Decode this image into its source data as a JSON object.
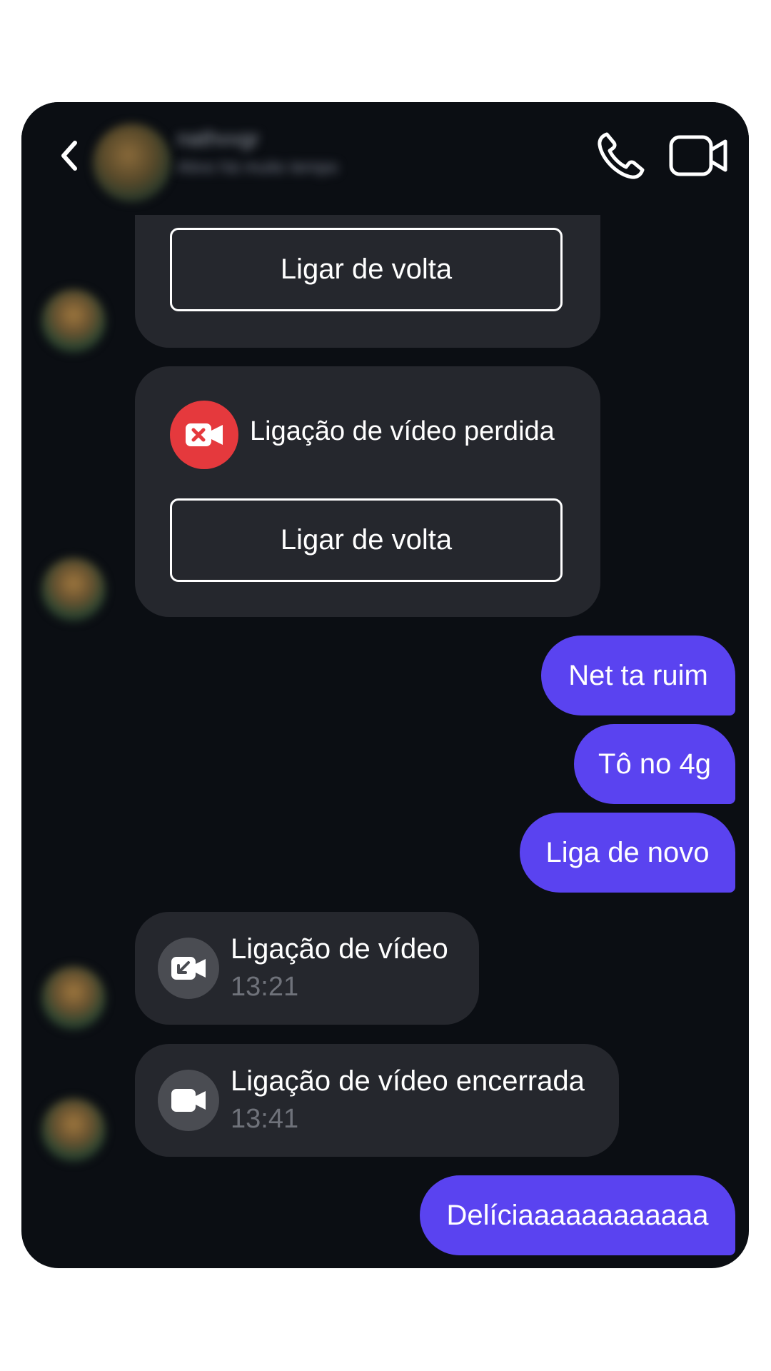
{
  "header": {
    "contact_name": "nathvvgr",
    "contact_sub": "Ativo há muito tempo"
  },
  "messages": {
    "callback_label_1": "Ligar de volta",
    "missed_video_label": "Ligação de vídeo perdida",
    "callback_label_2": "Ligar de volta",
    "out_1": "Net ta ruim",
    "out_2": "Tô no 4g",
    "out_3": "Liga de novo",
    "video_call_title": "Ligação de vídeo",
    "video_call_time": "13:21",
    "video_call_ended_title": "Ligação de vídeo encerrada",
    "video_call_ended_time": "13:41",
    "out_4": "Delíciaaaaaaaaaaaa"
  },
  "icons": {
    "back": "chevron-left-icon",
    "call": "phone-icon",
    "video": "video-camera-icon",
    "missed": "missed-video-icon",
    "incoming": "incoming-video-icon",
    "ended": "video-camera-icon"
  },
  "colors": {
    "screen_bg": "#0b0e13",
    "card_bg": "#25272d",
    "outgoing_bubble": "#5a43f0",
    "missed_red": "#e5393d",
    "muted_text": "#6f727a"
  }
}
